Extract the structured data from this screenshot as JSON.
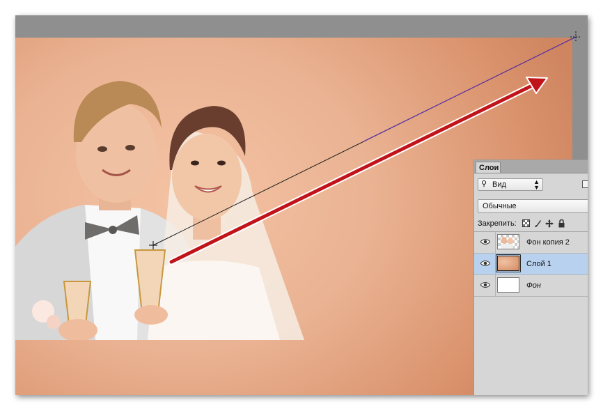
{
  "colors": {
    "canvas_light": "#f4c3a4",
    "canvas_dark": "#cf8660",
    "gray_workspace": "#8f8f8f",
    "arrow_red": "#c0141a",
    "selected_layer": "#b8d1ee"
  },
  "canvas": {
    "tool_cursor": "crosshair-icon",
    "guide_line": "gradient-line"
  },
  "layers_panel": {
    "tab_label": "Слои",
    "kind_filter_label": "Вид",
    "blend_mode": "Обычные",
    "lock_label": "Закрепить:",
    "lock_icons": [
      "lock-transparent-icon",
      "lock-paint-icon",
      "lock-position-icon",
      "lock-all-icon"
    ],
    "layers": [
      {
        "name": "Фон копия 2",
        "thumbnail": "transparent-photo",
        "visible": true,
        "selected": false
      },
      {
        "name": "Слой 1",
        "thumbnail": "gradient",
        "visible": true,
        "selected": true
      },
      {
        "name": "Фон",
        "thumbnail": "white",
        "visible": true,
        "selected": false,
        "locked_background": true
      }
    ]
  }
}
